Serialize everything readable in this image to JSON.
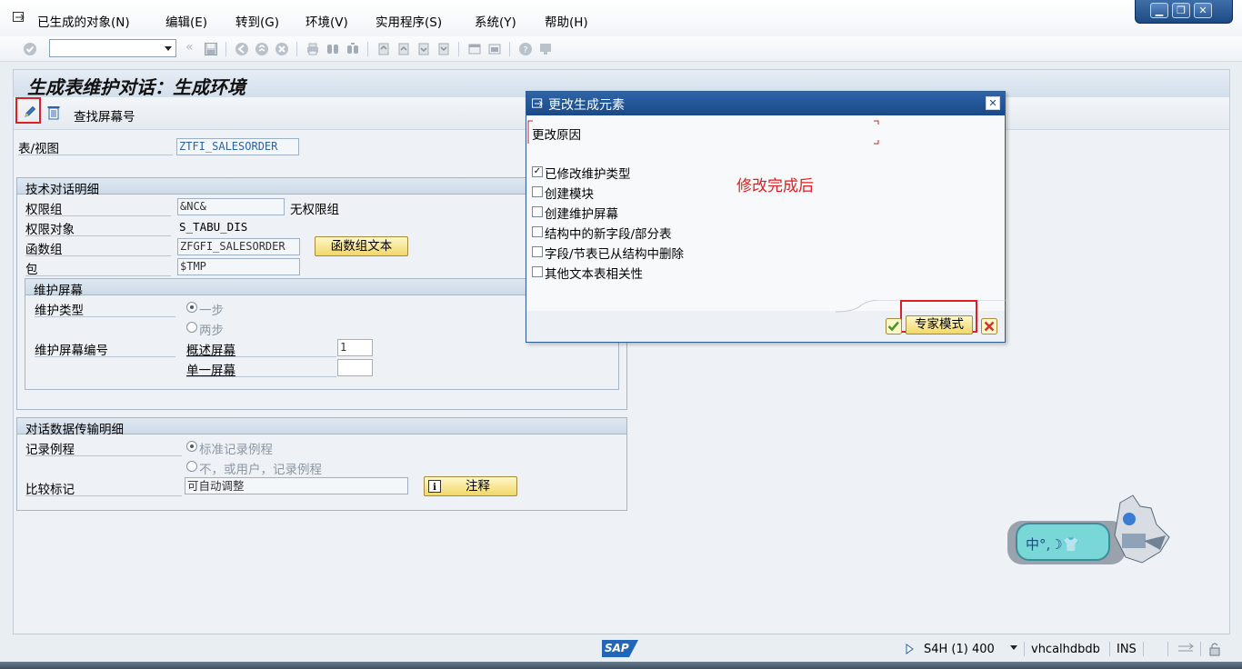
{
  "menu": {
    "items": [
      {
        "label": "已生成的对象(N)"
      },
      {
        "label": "编辑(E)"
      },
      {
        "label": "转到(G)"
      },
      {
        "label": "环境(V)"
      },
      {
        "label": "实用程序(S)"
      },
      {
        "label": "系统(Y)"
      },
      {
        "label": "帮助(H)"
      }
    ]
  },
  "page": {
    "title": "生成表维护对话：生成环境",
    "find_screen_label": "查找屏幕号"
  },
  "form": {
    "table_view_label": "表/视图",
    "table_view_value": "ZTFI_SALESORDER",
    "tech_group_title": "技术对话明细",
    "auth_group_label": "权限组",
    "auth_group_value": "&NC&",
    "auth_group_text": "无权限组",
    "auth_object_label": "权限对象",
    "auth_object_value": "S_TABU_DIS",
    "function_group_label": "函数组",
    "function_group_value": "ZFGFI_SALESORDER",
    "function_group_button": "函数组文本",
    "package_label": "包",
    "package_value": "$TMP",
    "maint_group_title": "维护屏幕",
    "maint_type_label": "维护类型",
    "maint_type_one": "一步",
    "maint_type_two": "两步",
    "screen_no_label": "维护屏幕编号",
    "overview_screen_label": "概述屏幕",
    "overview_screen_value": "1",
    "single_screen_label": "单一屏幕",
    "single_screen_value": "",
    "transport_group_title": "对话数据传输明细",
    "recording_label": "记录例程",
    "recording_standard": "标准记录例程",
    "recording_none": "不，或用户，记录例程",
    "compare_label": "比较标记",
    "compare_value": "可自动调整",
    "note_button": "注释"
  },
  "dialog": {
    "title": "更改生成元素",
    "reason_label": "更改原因",
    "options": [
      {
        "label": "已修改维护类型",
        "checked": true
      },
      {
        "label": "创建模块",
        "checked": false
      },
      {
        "label": "创建维护屏幕",
        "checked": false
      },
      {
        "label": "结构中的新字段/部分表",
        "checked": false
      },
      {
        "label": "字段/节表已从结构中删除",
        "checked": false
      },
      {
        "label": "其他文本表相关性",
        "checked": false
      }
    ],
    "annotation": "修改完成后",
    "expert_button": "专家模式"
  },
  "status": {
    "sap_logo": "SAP",
    "system": "S4H (1) 400",
    "host": "vhcalhdbdb",
    "mode": "INS"
  },
  "ime": {
    "text": "中°,☽👕"
  },
  "colors": {
    "accent": "#1a4987",
    "highlight": "#e02020",
    "button_yellow": "#f1d86b"
  }
}
